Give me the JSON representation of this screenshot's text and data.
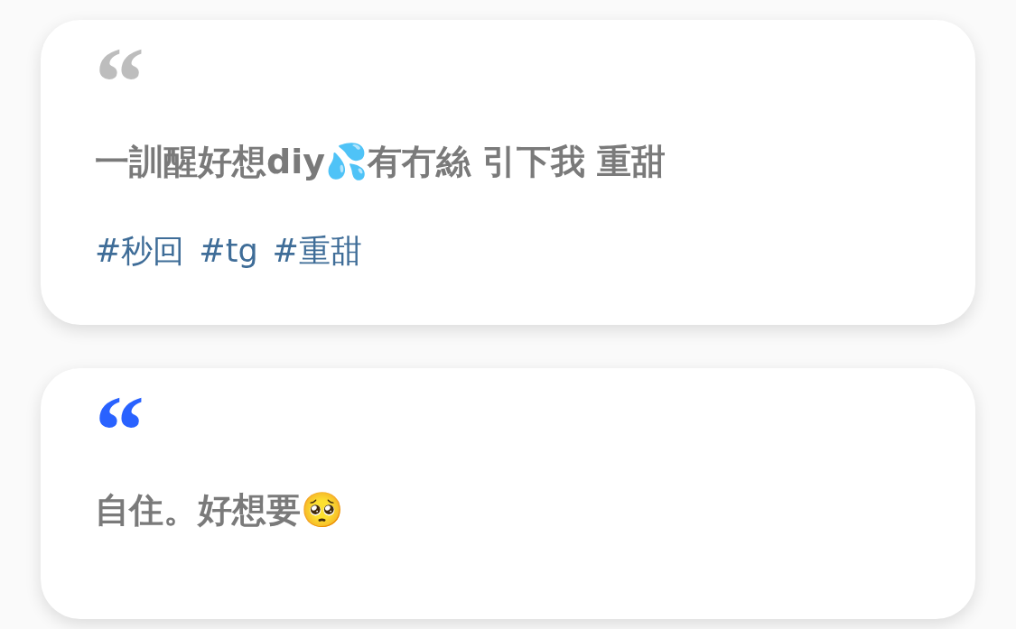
{
  "posts": [
    {
      "quote": "“",
      "color": "#bdbdbd",
      "text": "一訓醒好想diy💦有冇絲 引下我 重甜",
      "hashtags": [
        "#秒回",
        "#tg",
        "#重甜"
      ]
    },
    {
      "quote": "“",
      "color": "#2962ff",
      "text": "自住。好想要🥺"
    }
  ]
}
